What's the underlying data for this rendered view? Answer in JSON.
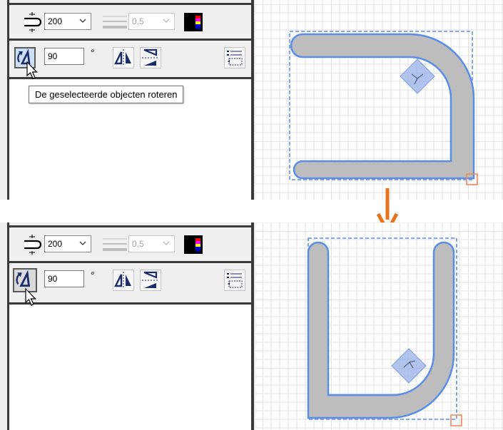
{
  "top_panel": {
    "line_width_value": "200",
    "stroke_value": "0,5",
    "rotate_angle_value": "90",
    "degree_symbol": "°",
    "tooltip": "De geselecteerde objecten roteren"
  },
  "bottom_panel": {
    "line_width_value": "200",
    "stroke_value": "0,5",
    "rotate_angle_value": "90",
    "degree_symbol": "°"
  },
  "colors": {
    "shape_fill": "#bdbdbd",
    "shape_stroke": "#5b8de8",
    "selection": "#5b8de8",
    "handle": "#f08a5d",
    "arrow": "#e8731d",
    "grid_minor": "#dcdcdc",
    "grid_major": "#c4c4c4"
  },
  "icons": [
    "line-width-icon",
    "stroke-lines-icon",
    "color-swatch-icon",
    "rotate-icon",
    "flip-horizontal-icon",
    "flip-vertical-icon",
    "properties-icon",
    "cursor-icon",
    "down-arrow-icon"
  ]
}
